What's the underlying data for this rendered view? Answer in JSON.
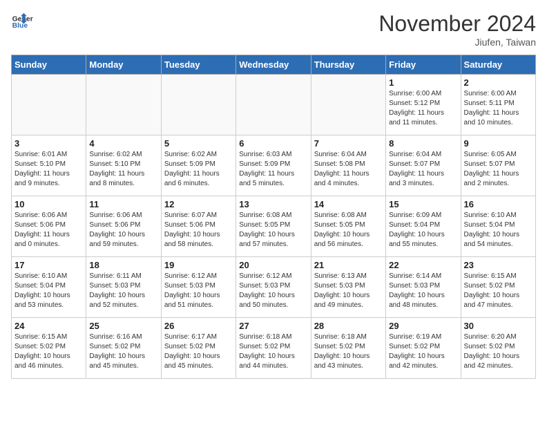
{
  "header": {
    "logo_line1": "General",
    "logo_line2": "Blue",
    "month_year": "November 2024",
    "location": "Jiufen, Taiwan"
  },
  "weekdays": [
    "Sunday",
    "Monday",
    "Tuesday",
    "Wednesday",
    "Thursday",
    "Friday",
    "Saturday"
  ],
  "weeks": [
    [
      {
        "day": "",
        "info": ""
      },
      {
        "day": "",
        "info": ""
      },
      {
        "day": "",
        "info": ""
      },
      {
        "day": "",
        "info": ""
      },
      {
        "day": "",
        "info": ""
      },
      {
        "day": "1",
        "info": "Sunrise: 6:00 AM\nSunset: 5:12 PM\nDaylight: 11 hours\nand 11 minutes."
      },
      {
        "day": "2",
        "info": "Sunrise: 6:00 AM\nSunset: 5:11 PM\nDaylight: 11 hours\nand 10 minutes."
      }
    ],
    [
      {
        "day": "3",
        "info": "Sunrise: 6:01 AM\nSunset: 5:10 PM\nDaylight: 11 hours\nand 9 minutes."
      },
      {
        "day": "4",
        "info": "Sunrise: 6:02 AM\nSunset: 5:10 PM\nDaylight: 11 hours\nand 8 minutes."
      },
      {
        "day": "5",
        "info": "Sunrise: 6:02 AM\nSunset: 5:09 PM\nDaylight: 11 hours\nand 6 minutes."
      },
      {
        "day": "6",
        "info": "Sunrise: 6:03 AM\nSunset: 5:09 PM\nDaylight: 11 hours\nand 5 minutes."
      },
      {
        "day": "7",
        "info": "Sunrise: 6:04 AM\nSunset: 5:08 PM\nDaylight: 11 hours\nand 4 minutes."
      },
      {
        "day": "8",
        "info": "Sunrise: 6:04 AM\nSunset: 5:07 PM\nDaylight: 11 hours\nand 3 minutes."
      },
      {
        "day": "9",
        "info": "Sunrise: 6:05 AM\nSunset: 5:07 PM\nDaylight: 11 hours\nand 2 minutes."
      }
    ],
    [
      {
        "day": "10",
        "info": "Sunrise: 6:06 AM\nSunset: 5:06 PM\nDaylight: 11 hours\nand 0 minutes."
      },
      {
        "day": "11",
        "info": "Sunrise: 6:06 AM\nSunset: 5:06 PM\nDaylight: 10 hours\nand 59 minutes."
      },
      {
        "day": "12",
        "info": "Sunrise: 6:07 AM\nSunset: 5:06 PM\nDaylight: 10 hours\nand 58 minutes."
      },
      {
        "day": "13",
        "info": "Sunrise: 6:08 AM\nSunset: 5:05 PM\nDaylight: 10 hours\nand 57 minutes."
      },
      {
        "day": "14",
        "info": "Sunrise: 6:08 AM\nSunset: 5:05 PM\nDaylight: 10 hours\nand 56 minutes."
      },
      {
        "day": "15",
        "info": "Sunrise: 6:09 AM\nSunset: 5:04 PM\nDaylight: 10 hours\nand 55 minutes."
      },
      {
        "day": "16",
        "info": "Sunrise: 6:10 AM\nSunset: 5:04 PM\nDaylight: 10 hours\nand 54 minutes."
      }
    ],
    [
      {
        "day": "17",
        "info": "Sunrise: 6:10 AM\nSunset: 5:04 PM\nDaylight: 10 hours\nand 53 minutes."
      },
      {
        "day": "18",
        "info": "Sunrise: 6:11 AM\nSunset: 5:03 PM\nDaylight: 10 hours\nand 52 minutes."
      },
      {
        "day": "19",
        "info": "Sunrise: 6:12 AM\nSunset: 5:03 PM\nDaylight: 10 hours\nand 51 minutes."
      },
      {
        "day": "20",
        "info": "Sunrise: 6:12 AM\nSunset: 5:03 PM\nDaylight: 10 hours\nand 50 minutes."
      },
      {
        "day": "21",
        "info": "Sunrise: 6:13 AM\nSunset: 5:03 PM\nDaylight: 10 hours\nand 49 minutes."
      },
      {
        "day": "22",
        "info": "Sunrise: 6:14 AM\nSunset: 5:03 PM\nDaylight: 10 hours\nand 48 minutes."
      },
      {
        "day": "23",
        "info": "Sunrise: 6:15 AM\nSunset: 5:02 PM\nDaylight: 10 hours\nand 47 minutes."
      }
    ],
    [
      {
        "day": "24",
        "info": "Sunrise: 6:15 AM\nSunset: 5:02 PM\nDaylight: 10 hours\nand 46 minutes."
      },
      {
        "day": "25",
        "info": "Sunrise: 6:16 AM\nSunset: 5:02 PM\nDaylight: 10 hours\nand 45 minutes."
      },
      {
        "day": "26",
        "info": "Sunrise: 6:17 AM\nSunset: 5:02 PM\nDaylight: 10 hours\nand 45 minutes."
      },
      {
        "day": "27",
        "info": "Sunrise: 6:18 AM\nSunset: 5:02 PM\nDaylight: 10 hours\nand 44 minutes."
      },
      {
        "day": "28",
        "info": "Sunrise: 6:18 AM\nSunset: 5:02 PM\nDaylight: 10 hours\nand 43 minutes."
      },
      {
        "day": "29",
        "info": "Sunrise: 6:19 AM\nSunset: 5:02 PM\nDaylight: 10 hours\nand 42 minutes."
      },
      {
        "day": "30",
        "info": "Sunrise: 6:20 AM\nSunset: 5:02 PM\nDaylight: 10 hours\nand 42 minutes."
      }
    ]
  ]
}
